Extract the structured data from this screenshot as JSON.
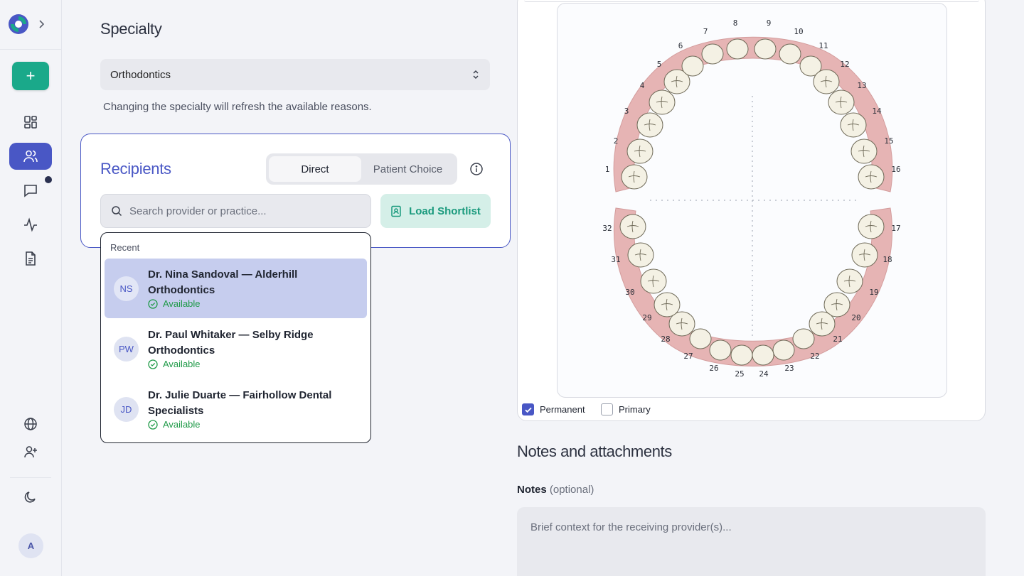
{
  "sidebar": {
    "new_label": "+",
    "avatar_initial": "A"
  },
  "specialty": {
    "title": "Specialty",
    "selected": "Orthodontics",
    "hint": "Changing the specialty will refresh the available reasons."
  },
  "recipients": {
    "title": "Recipients",
    "mode_options": [
      "Direct",
      "Patient Choice"
    ],
    "mode_selected": "Direct",
    "search_placeholder": "Search provider or practice...",
    "shortlist_label": "Load Shortlist",
    "dropdown": {
      "section_label": "Recent",
      "items": [
        {
          "initials": "NS",
          "name": "Dr. Nina Sandoval — Alderhill Orthodontics",
          "status": "Available",
          "highlighted": true
        },
        {
          "initials": "PW",
          "name": "Dr. Paul Whitaker — Selby Ridge Orthodontics",
          "status": "Available",
          "highlighted": false
        },
        {
          "initials": "JD",
          "name": "Dr. Julie Duarte — Fairhollow Dental Specialists",
          "status": "Available",
          "highlighted": false
        }
      ]
    }
  },
  "tooth_chart": {
    "numbers": [
      "1",
      "2",
      "3",
      "4",
      "5",
      "6",
      "7",
      "8",
      "9",
      "10",
      "11",
      "12",
      "13",
      "14",
      "15",
      "16",
      "17",
      "18",
      "19",
      "20",
      "21",
      "22",
      "23",
      "24",
      "25",
      "26",
      "27",
      "28",
      "29",
      "30",
      "31",
      "32"
    ],
    "permanent_label": "Permanent",
    "permanent_checked": true,
    "primary_label": "Primary",
    "primary_checked": false
  },
  "notes": {
    "title": "Notes and attachments",
    "label": "Notes",
    "optional": "(optional)",
    "placeholder": "Brief context for the receiving provider(s)..."
  },
  "colors": {
    "accent": "#4957c5",
    "teal": "#1aa98a",
    "available": "#1f9a48"
  }
}
